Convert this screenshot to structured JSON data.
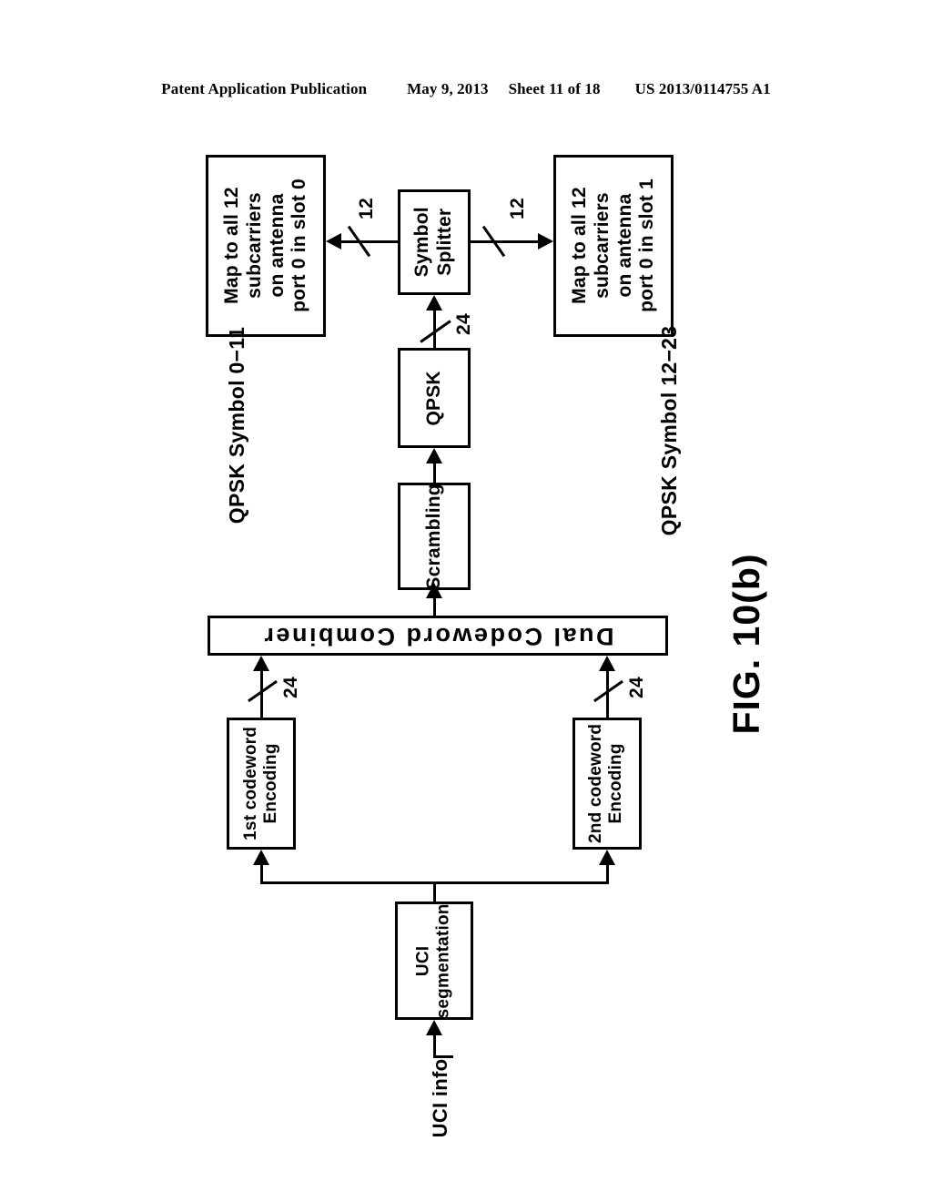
{
  "header": {
    "publication": "Patent Application Publication",
    "date": "May 9, 2013",
    "sheet": "Sheet 11 of 18",
    "patent_number": "US 2013/0114755 A1"
  },
  "figure": {
    "caption": "FIG. 10(b)"
  },
  "blocks": {
    "map_slot0": {
      "line1": "Map to all 12",
      "line2": "subcarriers",
      "line3": "on antenna",
      "line4": "port 0 in slot 0"
    },
    "map_slot1": {
      "line1": "Map to all 12",
      "line2": "subcarriers",
      "line3": "on antenna",
      "line4": "port 0 in slot 1"
    },
    "symbol_splitter": {
      "line1": "Symbol",
      "line2": "Splitter"
    },
    "qpsk": {
      "line1": "QPSK"
    },
    "scrambling": {
      "line1": "Scrambling"
    },
    "dual_codeword_combiner": {
      "line1": "Dual Codeword Combiner"
    },
    "first_codeword_encoding": {
      "line1": "1st codeword",
      "line2": "Encoding"
    },
    "second_codeword_encoding": {
      "line1": "2nd codeword",
      "line2": "Encoding"
    },
    "uci_segmentation": {
      "line1": "UCI",
      "line2": "segmentation"
    }
  },
  "annotations": {
    "qpsk_symbol_left": "QPSK Symbol 0−11",
    "qpsk_symbol_right": "QPSK Symbol 12−23",
    "input_label": "UCI info"
  },
  "wire_labels": {
    "splitter_to_slot0": "12",
    "splitter_to_slot1": "12",
    "qpsk_to_splitter": "24",
    "cw1_to_combiner": "24",
    "cw2_to_combiner": "24"
  }
}
